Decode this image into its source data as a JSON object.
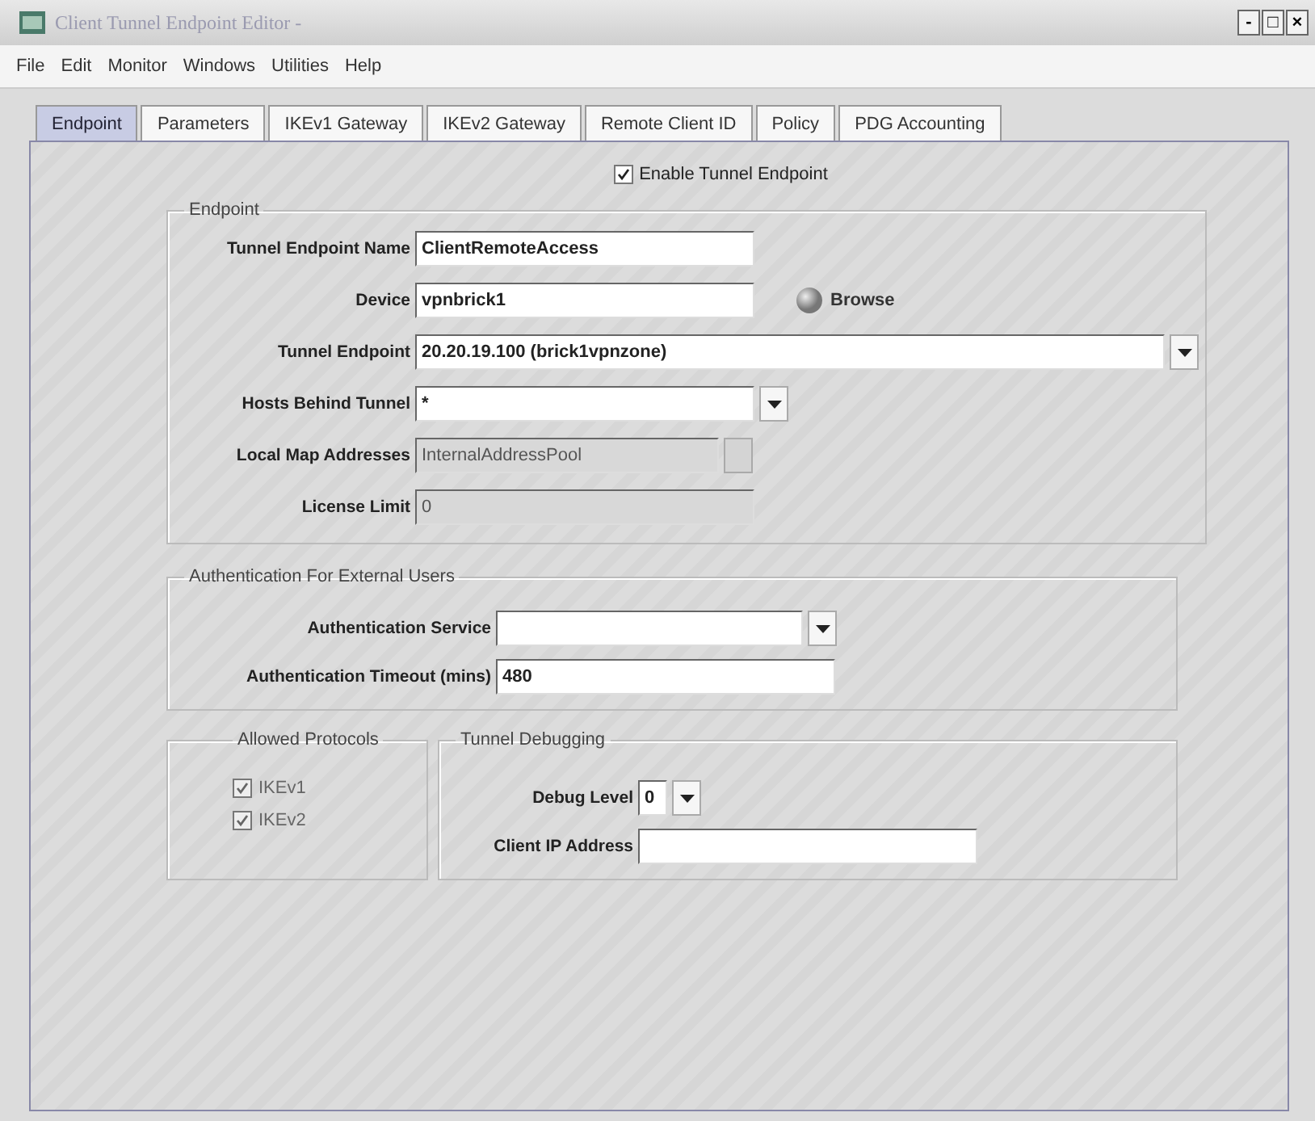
{
  "window": {
    "title": "Client Tunnel Endpoint Editor -",
    "controls": [
      "-",
      "□",
      "×"
    ]
  },
  "menu": [
    "File",
    "Edit",
    "Monitor",
    "Windows",
    "Utilities",
    "Help"
  ],
  "tabs": [
    {
      "label": "Endpoint",
      "selected": true
    },
    {
      "label": "Parameters",
      "selected": false
    },
    {
      "label": "IKEv1 Gateway",
      "selected": false
    },
    {
      "label": "IKEv2 Gateway",
      "selected": false
    },
    {
      "label": "Remote Client ID",
      "selected": false
    },
    {
      "label": "Policy",
      "selected": false
    },
    {
      "label": "PDG Accounting",
      "selected": false
    }
  ],
  "enable": {
    "label": "Enable Tunnel Endpoint",
    "checked": true
  },
  "endpoint": {
    "title": "Endpoint",
    "fields": [
      {
        "label": "Tunnel Endpoint Name",
        "kind": "text",
        "value": "ClientRemoteAccess",
        "disabled": false
      },
      {
        "label": "Device",
        "kind": "text",
        "value": "vpnbrick1",
        "disabled": false,
        "button": "Browse"
      },
      {
        "label": "Tunnel Endpoint",
        "kind": "combo",
        "value": "20.20.19.100 (brick1vpnzone)",
        "disabled": false
      },
      {
        "label": "Hosts Behind Tunnel",
        "kind": "combo",
        "value": "*",
        "disabled": false
      },
      {
        "label": "Local Map Addresses",
        "kind": "picker",
        "value": "InternalAddressPool",
        "disabled": true
      },
      {
        "label": "License Limit",
        "kind": "text",
        "value": "0",
        "disabled": true
      }
    ]
  },
  "auth": {
    "title": "Authentication For External Users",
    "fields": [
      {
        "label": "Authentication Service",
        "kind": "combo",
        "disabled": false
      },
      {
        "label": "Authentication Timeout (mins)",
        "kind": "text",
        "value": "480",
        "disabled": false
      }
    ]
  },
  "protocols": {
    "title": "Allowed Protocols",
    "items": [
      {
        "label": "IKEv1",
        "checked": true
      },
      {
        "label": "IKEv2",
        "checked": true
      }
    ]
  },
  "debugging": {
    "title": "Tunnel Debugging",
    "fields": [
      {
        "label": "Debug Level",
        "kind": "combo",
        "value": "0",
        "disabled": false
      },
      {
        "label": "Client IP Address",
        "kind": "text",
        "disabled": false
      }
    ]
  }
}
